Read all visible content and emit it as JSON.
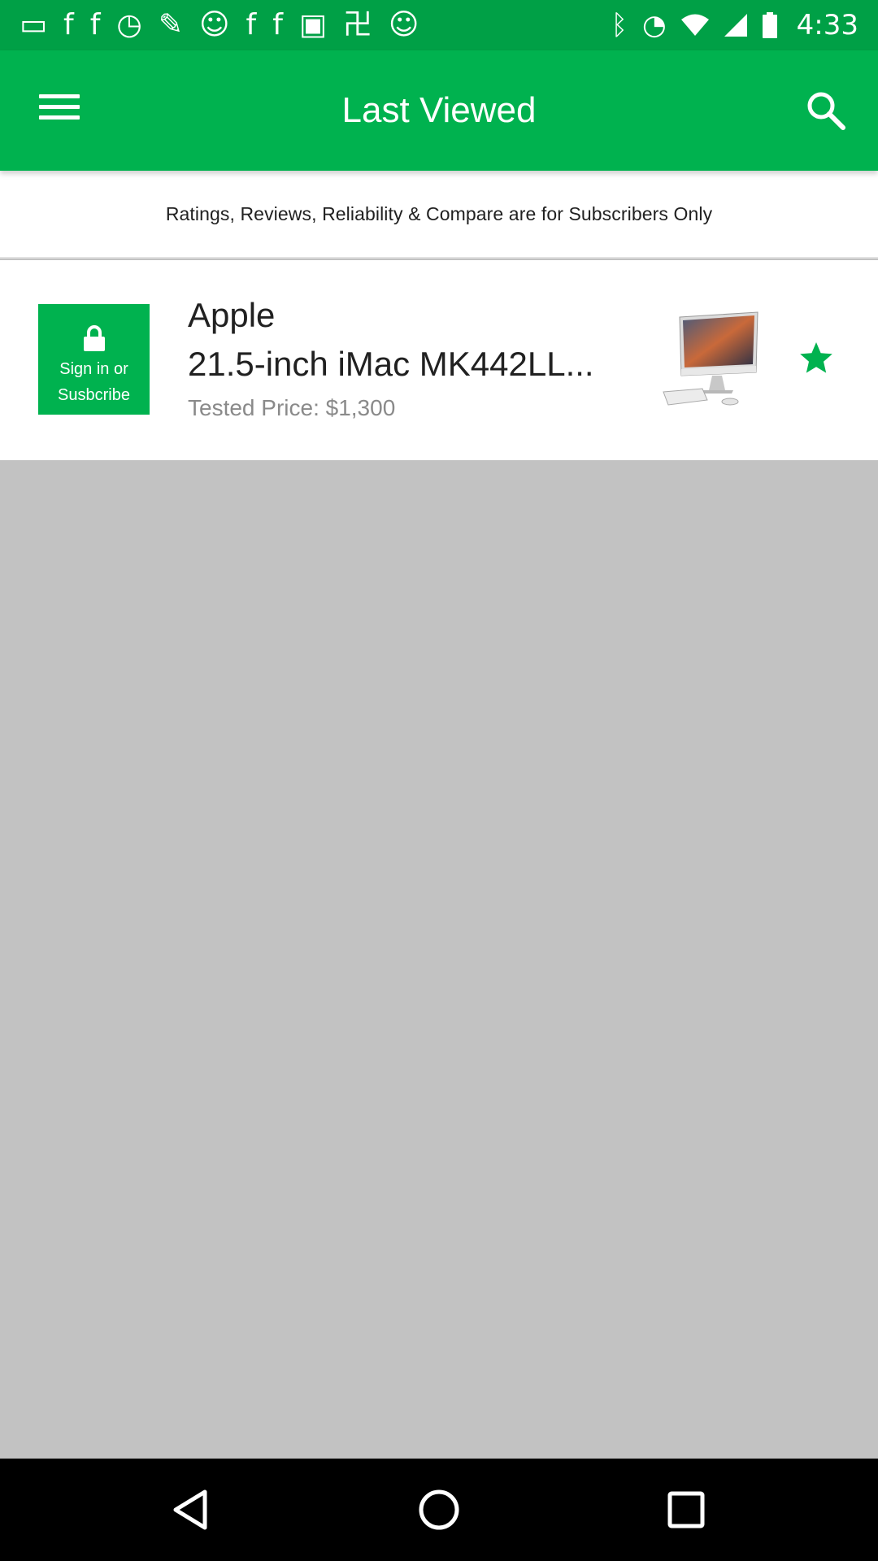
{
  "status_bar": {
    "time": "4:33",
    "left_icons": [
      "chat-icon",
      "facebook-icon",
      "facebook-icon",
      "stopwatch-icon",
      "wrench-icon",
      "smiley-icon",
      "facebook-icon",
      "facebook-icon",
      "qt-icon",
      "chinese-char-icon",
      "smiley-icon"
    ],
    "right_icons": [
      "bluetooth-icon",
      "alarm-icon",
      "wifi-icon",
      "signal-icon",
      "battery-icon"
    ]
  },
  "app_bar": {
    "title": "Last Viewed",
    "menu_icon": "menu-icon",
    "search_icon": "search-icon"
  },
  "banner": {
    "text": "Ratings, Reviews, Reliability & Compare are for Subscribers Only"
  },
  "items": [
    {
      "lock_label": "Sign in or\nSusbcribe",
      "brand": "Apple",
      "model": "21.5-inch iMac MK442LL...",
      "price": "Tested Price: $1,300",
      "image": "imac-desktop",
      "favorite": true
    }
  ],
  "colors": {
    "app_bar": "#00b24f",
    "status_bar": "#00a046",
    "content_background": "#c2c2c2",
    "accent": "#00b24f"
  },
  "nav_bar": {
    "icons": [
      "back-icon",
      "home-icon",
      "recents-icon"
    ]
  }
}
